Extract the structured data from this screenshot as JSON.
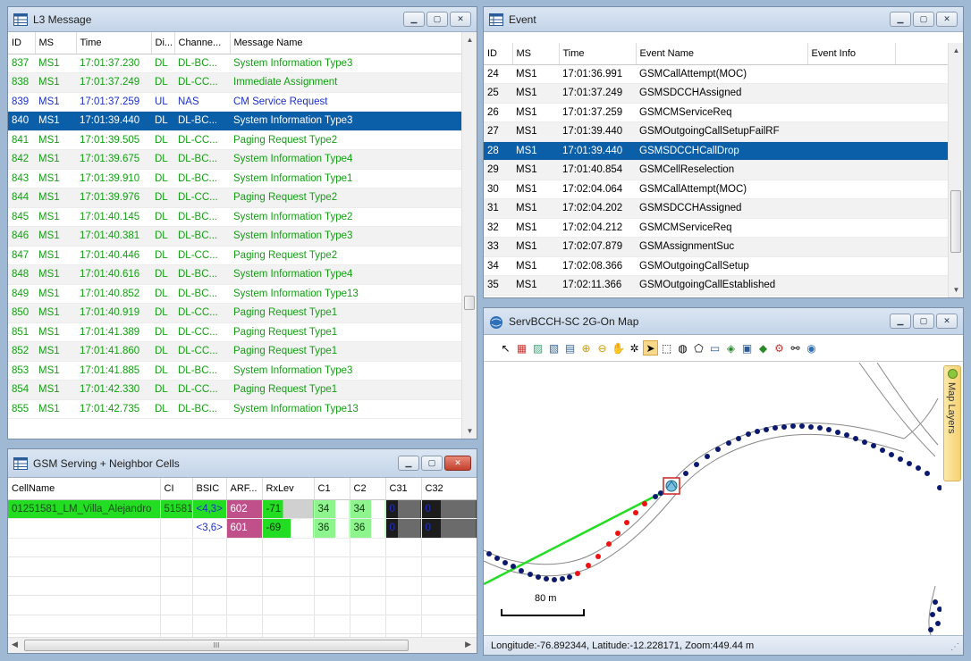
{
  "l3": {
    "title": "L3 Message",
    "columns": [
      "ID",
      "MS",
      "Time",
      "Di...",
      "Channe...",
      "Message Name"
    ],
    "rows": [
      {
        "id": "837",
        "ms": "MS1",
        "time": "17:01:37.230",
        "dir": "DL",
        "chan": "DL-BC...",
        "msg": "System Information Type3",
        "color": "green"
      },
      {
        "id": "838",
        "ms": "MS1",
        "time": "17:01:37.249",
        "dir": "DL",
        "chan": "DL-CC...",
        "msg": "Immediate Assignment",
        "color": "green"
      },
      {
        "id": "839",
        "ms": "MS1",
        "time": "17:01:37.259",
        "dir": "UL",
        "chan": "NAS",
        "msg": "CM Service Request",
        "color": "blue"
      },
      {
        "id": "840",
        "ms": "MS1",
        "time": "17:01:39.440",
        "dir": "DL",
        "chan": "DL-BC...",
        "msg": "System Information Type3",
        "color": "selected"
      },
      {
        "id": "841",
        "ms": "MS1",
        "time": "17:01:39.505",
        "dir": "DL",
        "chan": "DL-CC...",
        "msg": "Paging Request Type2",
        "color": "green"
      },
      {
        "id": "842",
        "ms": "MS1",
        "time": "17:01:39.675",
        "dir": "DL",
        "chan": "DL-BC...",
        "msg": "System Information Type4",
        "color": "green"
      },
      {
        "id": "843",
        "ms": "MS1",
        "time": "17:01:39.910",
        "dir": "DL",
        "chan": "DL-BC...",
        "msg": "System Information Type1",
        "color": "green"
      },
      {
        "id": "844",
        "ms": "MS1",
        "time": "17:01:39.976",
        "dir": "DL",
        "chan": "DL-CC...",
        "msg": "Paging Request Type2",
        "color": "green"
      },
      {
        "id": "845",
        "ms": "MS1",
        "time": "17:01:40.145",
        "dir": "DL",
        "chan": "DL-BC...",
        "msg": "System Information Type2",
        "color": "green"
      },
      {
        "id": "846",
        "ms": "MS1",
        "time": "17:01:40.381",
        "dir": "DL",
        "chan": "DL-BC...",
        "msg": "System Information Type3",
        "color": "green"
      },
      {
        "id": "847",
        "ms": "MS1",
        "time": "17:01:40.446",
        "dir": "DL",
        "chan": "DL-CC...",
        "msg": "Paging Request Type2",
        "color": "green"
      },
      {
        "id": "848",
        "ms": "MS1",
        "time": "17:01:40.616",
        "dir": "DL",
        "chan": "DL-BC...",
        "msg": "System Information Type4",
        "color": "green"
      },
      {
        "id": "849",
        "ms": "MS1",
        "time": "17:01:40.852",
        "dir": "DL",
        "chan": "DL-BC...",
        "msg": "System Information Type13",
        "color": "green"
      },
      {
        "id": "850",
        "ms": "MS1",
        "time": "17:01:40.919",
        "dir": "DL",
        "chan": "DL-CC...",
        "msg": "Paging Request Type1",
        "color": "green"
      },
      {
        "id": "851",
        "ms": "MS1",
        "time": "17:01:41.389",
        "dir": "DL",
        "chan": "DL-CC...",
        "msg": "Paging Request Type1",
        "color": "green"
      },
      {
        "id": "852",
        "ms": "MS1",
        "time": "17:01:41.860",
        "dir": "DL",
        "chan": "DL-CC...",
        "msg": "Paging Request Type1",
        "color": "green"
      },
      {
        "id": "853",
        "ms": "MS1",
        "time": "17:01:41.885",
        "dir": "DL",
        "chan": "DL-BC...",
        "msg": "System Information Type3",
        "color": "green"
      },
      {
        "id": "854",
        "ms": "MS1",
        "time": "17:01:42.330",
        "dir": "DL",
        "chan": "DL-CC...",
        "msg": "Paging Request Type1",
        "color": "green"
      },
      {
        "id": "855",
        "ms": "MS1",
        "time": "17:01:42.735",
        "dir": "DL",
        "chan": "DL-BC...",
        "msg": "System Information Type13",
        "color": "green"
      }
    ]
  },
  "event": {
    "title": "Event",
    "columns": [
      "ID",
      "MS",
      "Time",
      "Event Name",
      "Event Info"
    ],
    "rows": [
      {
        "id": "24",
        "ms": "MS1",
        "time": "17:01:36.991",
        "name": "GSMCallAttempt(MOC)",
        "info": ""
      },
      {
        "id": "25",
        "ms": "MS1",
        "time": "17:01:37.249",
        "name": "GSMSDCCHAssigned",
        "info": ""
      },
      {
        "id": "26",
        "ms": "MS1",
        "time": "17:01:37.259",
        "name": "GSMCMServiceReq",
        "info": ""
      },
      {
        "id": "27",
        "ms": "MS1",
        "time": "17:01:39.440",
        "name": "GSMOutgoingCallSetupFailRF",
        "info": ""
      },
      {
        "id": "28",
        "ms": "MS1",
        "time": "17:01:39.440",
        "name": "GSMSDCCHCallDrop",
        "info": "",
        "selected": true
      },
      {
        "id": "29",
        "ms": "MS1",
        "time": "17:01:40.854",
        "name": "GSMCellReselection",
        "info": ""
      },
      {
        "id": "30",
        "ms": "MS1",
        "time": "17:02:04.064",
        "name": "GSMCallAttempt(MOC)",
        "info": ""
      },
      {
        "id": "31",
        "ms": "MS1",
        "time": "17:02:04.202",
        "name": "GSMSDCCHAssigned",
        "info": ""
      },
      {
        "id": "32",
        "ms": "MS1",
        "time": "17:02:04.212",
        "name": "GSMCMServiceReq",
        "info": ""
      },
      {
        "id": "33",
        "ms": "MS1",
        "time": "17:02:07.879",
        "name": "GSMAssignmentSuc",
        "info": ""
      },
      {
        "id": "34",
        "ms": "MS1",
        "time": "17:02:08.366",
        "name": "GSMOutgoingCallSetup",
        "info": ""
      },
      {
        "id": "35",
        "ms": "MS1",
        "time": "17:02:11.366",
        "name": "GSMOutgoingCallEstablished",
        "info": ""
      }
    ]
  },
  "gsm": {
    "title": "GSM Serving + Neighbor Cells",
    "columns": [
      "CellName",
      "CI",
      "BSIC",
      "ARF...",
      "RxLev",
      "C1",
      "C2",
      "C31",
      "C32"
    ],
    "rows": [
      {
        "cell": "01251581_LM_Villa_Alejandro",
        "ci": "51581",
        "bsic": "<4,3>",
        "arfcn": "602",
        "rxlev": "-71",
        "c1": "34",
        "c2": "34",
        "c31": "0",
        "c32": "0"
      },
      {
        "cell": "",
        "ci": "",
        "bsic": "<3,6>",
        "arfcn": "601",
        "rxlev": "-69",
        "c1": "36",
        "c2": "36",
        "c31": "0",
        "c32": "0"
      }
    ],
    "scroll_thumb_glyph": "III"
  },
  "map": {
    "title": "ServBCCH-SC 2G-On Map",
    "scale_label": "80 m",
    "layers_tab": "Map Layers",
    "status": "Longitude:-76.892344, Latitude:-12.228171, Zoom:449.44 m"
  },
  "colors": {
    "selection": "#0a5fa8",
    "green_text": "#13a013",
    "blue_text": "#1c2fc9",
    "serving_green": "#22dd22",
    "arfcn_magenta": "#c0508a",
    "track_navy": "#0c1a6e",
    "track_red": "#ee1111"
  }
}
